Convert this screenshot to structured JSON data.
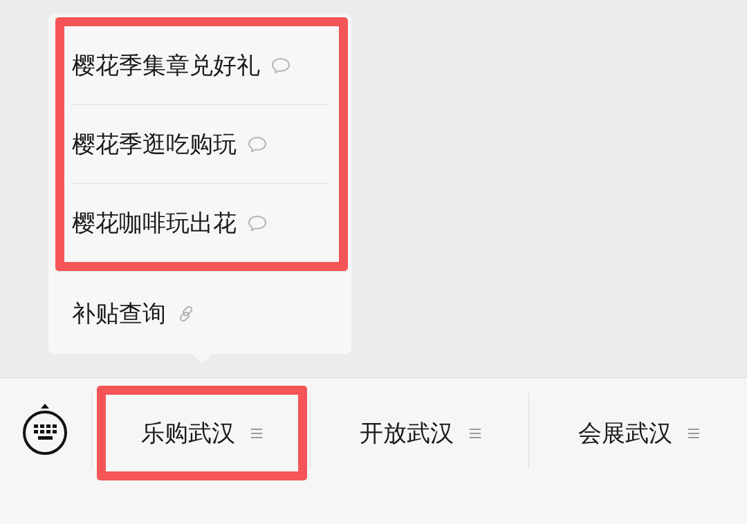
{
  "popup_menu": {
    "items": [
      {
        "label": "樱花季集章兑好礼",
        "kind": "message",
        "highlighted": true
      },
      {
        "label": "樱花季逛吃购玩",
        "kind": "message",
        "highlighted": true
      },
      {
        "label": "樱花咖啡玩出花",
        "kind": "message",
        "highlighted": true
      },
      {
        "label": "补贴查询",
        "kind": "link",
        "highlighted": false
      }
    ]
  },
  "menu_bar": {
    "tabs": [
      {
        "label": "乐购武汉",
        "highlighted": true
      },
      {
        "label": "开放武汉",
        "highlighted": false
      },
      {
        "label": "会展武汉",
        "highlighted": false
      }
    ]
  }
}
